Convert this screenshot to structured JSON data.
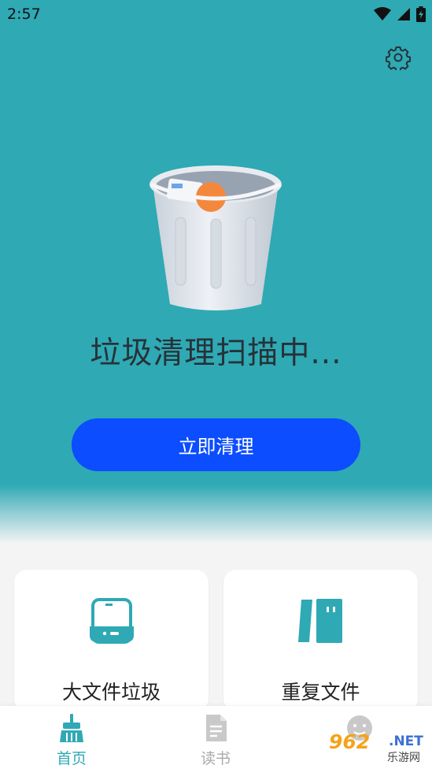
{
  "status_bar": {
    "time": "2:57"
  },
  "main": {
    "scan_title": "垃圾清理扫描中...",
    "clean_button": "立即清理"
  },
  "cards": [
    {
      "label": "大文件垃圾",
      "icon": "storage-drive-icon"
    },
    {
      "label": "重复文件",
      "icon": "duplicate-files-icon"
    }
  ],
  "bottom_nav": [
    {
      "label": "首页",
      "icon": "broom-icon",
      "active": true
    },
    {
      "label": "读书",
      "icon": "document-icon",
      "active": false
    },
    {
      "label": "",
      "icon": "profile-face-icon",
      "active": false
    }
  ],
  "watermark": {
    "brand": "962",
    "domain": ".NET",
    "sub": "乐游网"
  },
  "colors": {
    "accent": "#2fa9b4",
    "button": "#0b4dff",
    "title": "#263238"
  }
}
